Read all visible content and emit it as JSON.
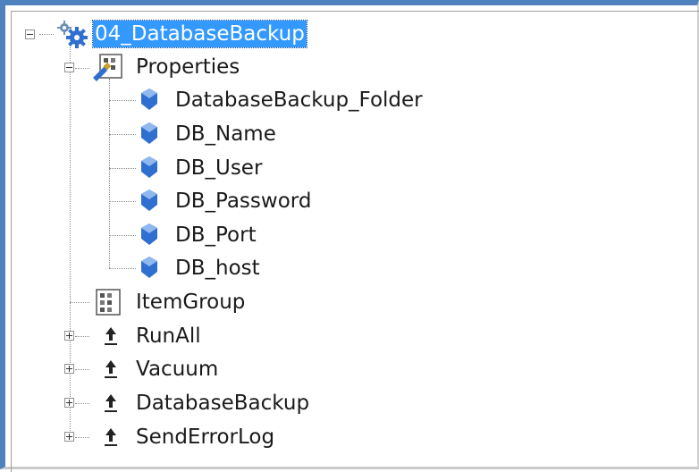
{
  "tree": {
    "root": {
      "label": "04_DatabaseBackup",
      "icon": "gears-icon",
      "expanded": true,
      "selected": true
    },
    "properties": {
      "label": "Properties",
      "icon": "property-group-icon",
      "expanded": true,
      "items": [
        {
          "label": "DatabaseBackup_Folder",
          "icon": "property-icon"
        },
        {
          "label": "DB_Name",
          "icon": "property-icon"
        },
        {
          "label": "DB_User",
          "icon": "property-icon"
        },
        {
          "label": "DB_Password",
          "icon": "property-icon"
        },
        {
          "label": "DB_Port",
          "icon": "property-icon"
        },
        {
          "label": "DB_host",
          "icon": "property-icon"
        }
      ]
    },
    "item_group": {
      "label": "ItemGroup",
      "icon": "item-group-icon"
    },
    "targets": [
      {
        "label": "RunAll",
        "icon": "target-icon",
        "expanded": false
      },
      {
        "label": "Vacuum",
        "icon": "target-icon",
        "expanded": false
      },
      {
        "label": "DatabaseBackup",
        "icon": "target-icon",
        "expanded": false
      },
      {
        "label": "SendErrorLog",
        "icon": "target-icon",
        "expanded": false
      }
    ]
  },
  "colors": {
    "selection": "#3399ff",
    "window_border": "#4f81bd",
    "property_icon": "#2f6fd0"
  }
}
